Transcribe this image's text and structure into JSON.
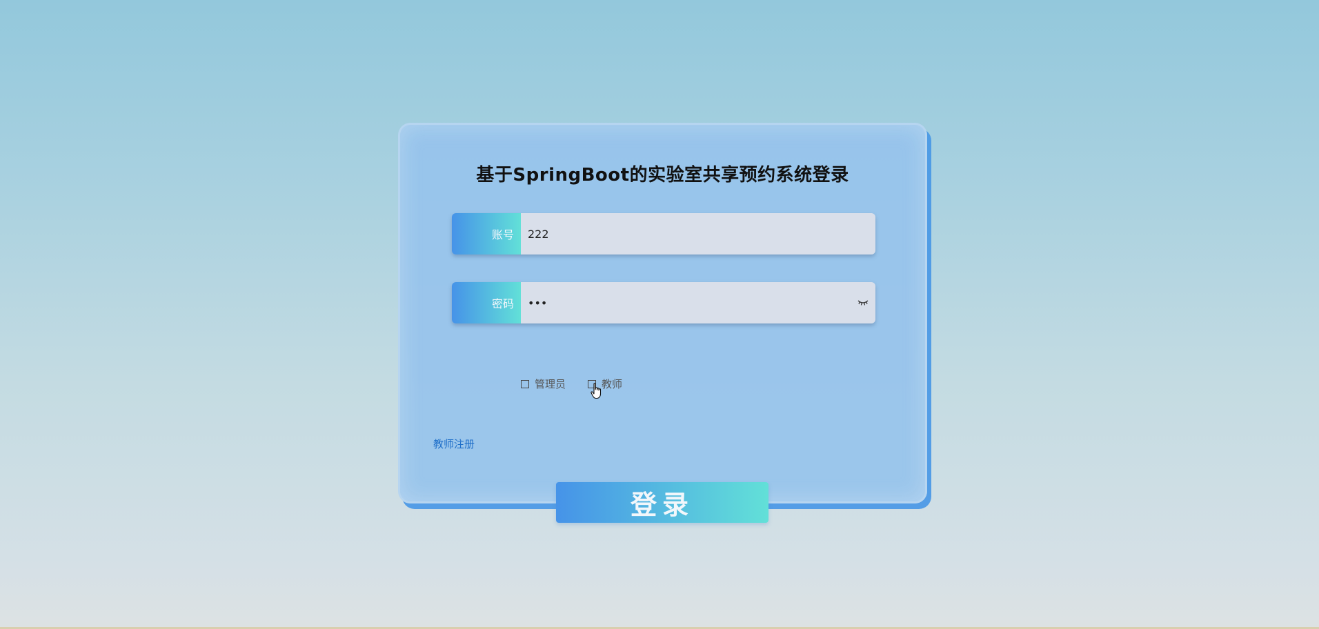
{
  "login": {
    "title": "基于SpringBoot的实验室共享预约系统登录",
    "account": {
      "label": "账号",
      "value": "222"
    },
    "password": {
      "label": "密码",
      "value": "•••",
      "toggle_icon": "eye-closed-icon"
    },
    "roles": [
      {
        "label": "管理员",
        "checked": false
      },
      {
        "label": "教师",
        "checked": false
      }
    ],
    "register_link": "教师注册",
    "submit_label": "登录"
  },
  "colors": {
    "accent_gradient_start": "#4693e8",
    "accent_gradient_end": "#62e0d8",
    "card_background": "#97c3ec",
    "link": "#1f6fc9"
  }
}
